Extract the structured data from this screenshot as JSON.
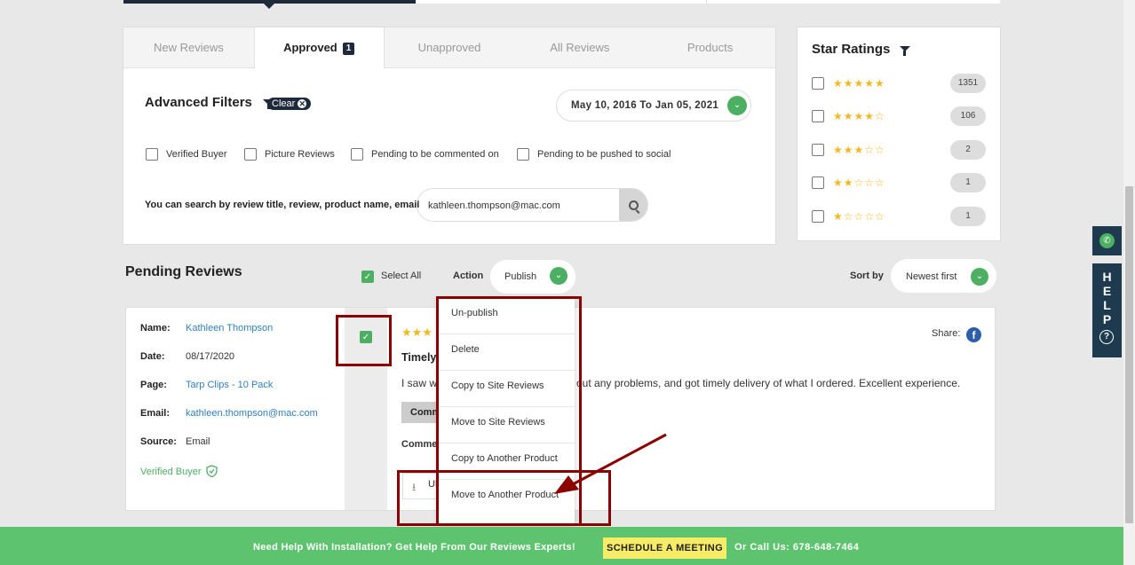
{
  "tabs": [
    {
      "label": "New Reviews"
    },
    {
      "label": "Approved",
      "badge": "1"
    },
    {
      "label": "Unapproved"
    },
    {
      "label": "All Reviews"
    },
    {
      "label": "Products"
    }
  ],
  "filters": {
    "title": "Advanced Filters",
    "clear_label": "Clear",
    "date_range": "May 10, 2016 To Jan 05, 2021",
    "checkboxes": [
      "Verified Buyer",
      "Picture Reviews",
      "Pending to be commented on",
      "Pending to be pushed to social"
    ],
    "search_label": "You can search by review title, review, product name, email",
    "search_value": "kathleen.thompson@mac.com"
  },
  "star_ratings": {
    "title": "Star Ratings",
    "rows": [
      {
        "stars": "★★★★★",
        "count": "1351"
      },
      {
        "stars": "★★★★☆",
        "count": "106"
      },
      {
        "stars": "★★★☆☆",
        "count": "2"
      },
      {
        "stars": "★★☆☆☆",
        "count": "1"
      },
      {
        "stars": "★☆☆☆☆",
        "count": "1"
      }
    ]
  },
  "pending": {
    "title": "Pending Reviews",
    "select_all": "Select All",
    "action_label": "Action",
    "action_value": "Publish",
    "sort_label": "Sort by",
    "sort_value": "Newest first"
  },
  "review": {
    "name_label": "Name:",
    "name": "Kathleen Thompson",
    "date_label": "Date:",
    "date": "08/17/2020",
    "page_label": "Page:",
    "page": "Tarp Clips - 10 Pack",
    "email_label": "Email:",
    "email": "kathleen.thompson@mac.com",
    "source_label": "Source:",
    "source": "Email",
    "verified": "Verified Buyer",
    "stars": "★★★",
    "title_partial": "Timely",
    "text_left": "I saw w",
    "text_right": "out any problems, and got timely delivery of what I ordered. Excellent experience.",
    "comment_btn_partial": "Comm",
    "comments_partial": "Comme",
    "upload_partial": "Ul",
    "share_label": "Share:"
  },
  "action_menu": [
    "Un-publish",
    "Delete",
    "Copy to Site Reviews",
    "Move to Site Reviews",
    "Copy to Another Product",
    "Move to Another Product"
  ],
  "help": {
    "letters": [
      "H",
      "E",
      "L",
      "P"
    ],
    "question": "?"
  },
  "footer": {
    "message": "Need Help With Installation? Get Help From Our Reviews Experts!",
    "schedule_button": "SCHEDULE A MEETING",
    "call": "Or Call Us: 678-648-7464"
  },
  "colors": {
    "navy": "#1e2a3a",
    "green": "#4caf62",
    "footer": "#5ec36e",
    "star": "#f2b824",
    "highlight_red": "#8b0000"
  }
}
